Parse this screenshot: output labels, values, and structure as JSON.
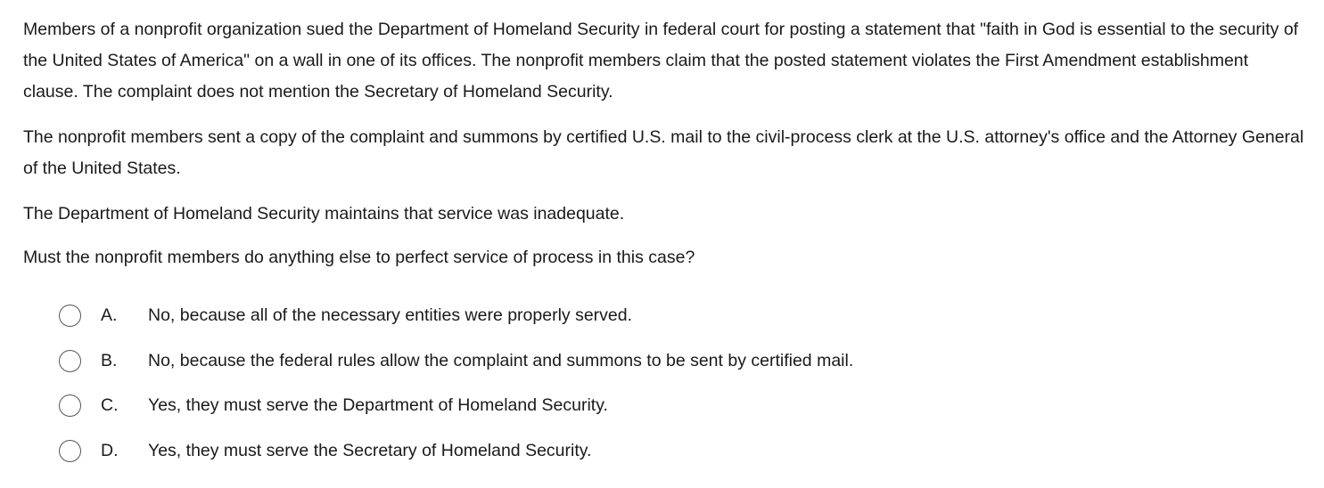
{
  "question": {
    "paragraphs": [
      "Members of a nonprofit organization sued the Department of Homeland Security in federal court for posting a statement that \"faith in God is essential to the security of the United States of America\" on a wall in one of its offices.  The nonprofit members claim that the posted statement violates the First Amendment establishment clause.  The complaint does not mention the Secretary of Homeland Security.",
      "The nonprofit members sent a copy of the complaint and summons by certified U.S. mail to the civil-process clerk at the U.S. attorney's office and the Attorney General of the United States.",
      "The Department of Homeland Security maintains that service was inadequate.",
      "Must the nonprofit members do anything else to perfect service of process in this case?"
    ]
  },
  "options": [
    {
      "letter": "A.",
      "text": "No, because all of the necessary entities were properly served."
    },
    {
      "letter": "B.",
      "text": "No, because the federal rules allow the complaint and summons to be sent by certified mail."
    },
    {
      "letter": "C.",
      "text": "Yes, they must serve the Department of Homeland Security."
    },
    {
      "letter": "D.",
      "text": "Yes, they must serve the Secretary of Homeland Security."
    }
  ],
  "selected_option": null
}
